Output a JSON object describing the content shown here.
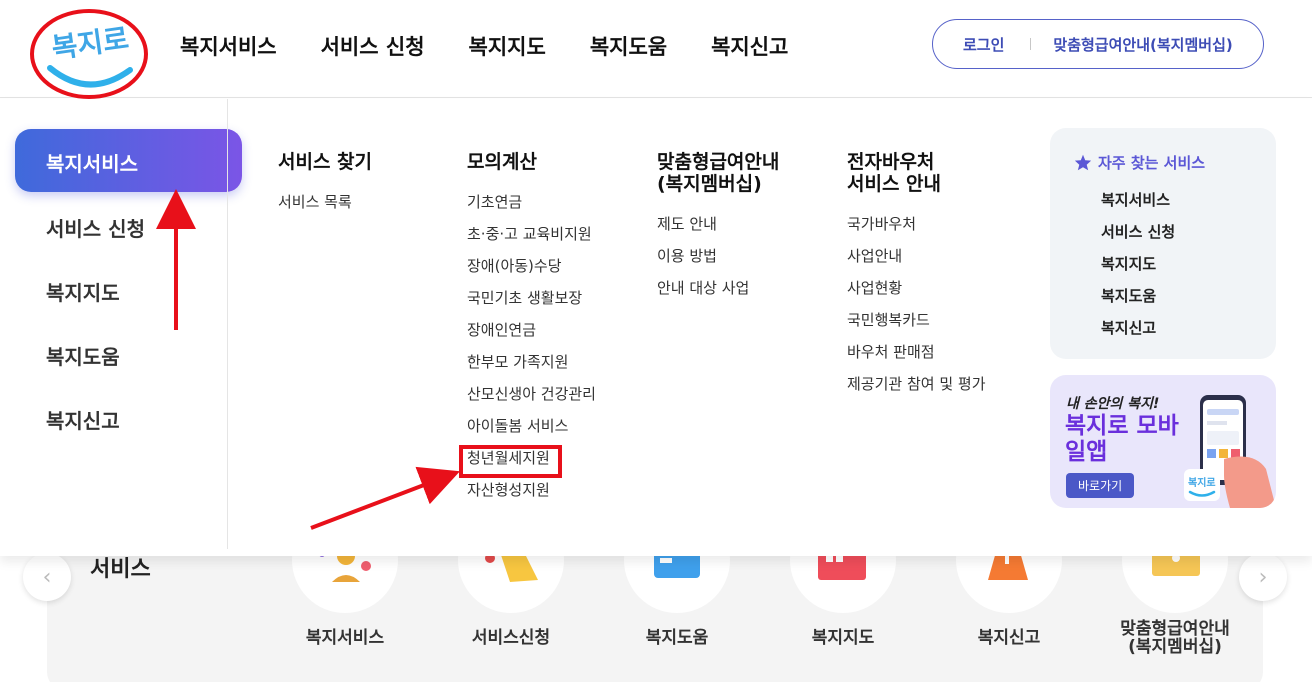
{
  "header": {
    "logo_text": "복지로",
    "nav": [
      "복지서비스",
      "서비스 신청",
      "복지지도",
      "복지도움",
      "복지신고"
    ],
    "login": "로그인",
    "member_guide": "맞춤형급여안내(복지멤버십)"
  },
  "mega_menu": {
    "side": {
      "active": "복지서비스",
      "items": [
        "서비스 신청",
        "복지지도",
        "복지도움",
        "복지신고"
      ]
    },
    "columns": [
      {
        "head": "서비스 찾기",
        "items": [
          "서비스 목록"
        ]
      },
      {
        "head": "모의계산",
        "items": [
          "기초연금",
          "초·중·고 교육비지원",
          "장애(아동)수당",
          "국민기초 생활보장",
          "장애인연금",
          "한부모 가족지원",
          "산모신생아 건강관리",
          "아이돌봄 서비스",
          "청년월세지원",
          "자산형성지원"
        ]
      },
      {
        "head_line1": "맞춤형급여안내",
        "head_line2": "(복지멤버십)",
        "items": [
          "제도 안내",
          "이용 방법",
          "안내 대상 사업"
        ]
      },
      {
        "head_line1": "전자바우처",
        "head_line2": "서비스 안내",
        "items": [
          "국가바우처",
          "사업안내",
          "사업현황",
          "국민행복카드",
          "바우처 판매점",
          "제공기관 참여 및 평가"
        ]
      }
    ],
    "favorites": {
      "title": "자주 찾는 서비스",
      "items": [
        "복지서비스",
        "서비스 신청",
        "복지지도",
        "복지도움",
        "복지신고"
      ]
    },
    "banner": {
      "subtitle": "내 손안의 복지!",
      "title": "복지로 모바일앱",
      "button": "바로가기",
      "phone_logo": "복지로"
    }
  },
  "background": {
    "section_title": "서비스",
    "quick_items": [
      "복지서비스",
      "서비스신청",
      "복지도움",
      "복지지도",
      "복지신고"
    ],
    "last_item_line1": "맞춤형급여안내",
    "last_item_line2": "(복지멤버십)"
  },
  "colors": {
    "accent": "#5b57d6",
    "annotation_red": "#e8101a",
    "active_gradient_start": "#3f6adb",
    "active_gradient_end": "#7b55e6"
  }
}
